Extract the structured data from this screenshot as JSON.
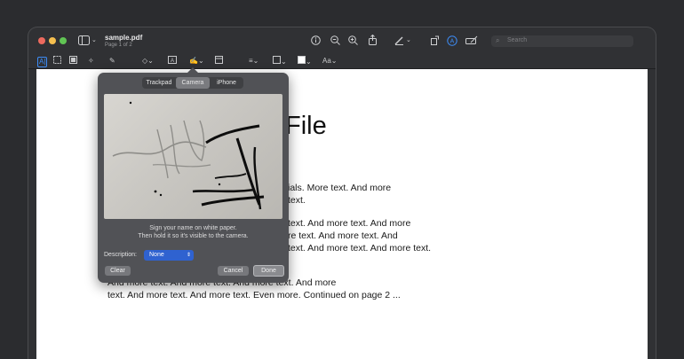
{
  "window": {
    "title": "sample.pdf",
    "subtitle": "Page 1 of 2",
    "search_placeholder": "Search"
  },
  "icons": {
    "sidebar": "sidebar-icon",
    "info": "info-icon",
    "zoom_out": "zoom-out-icon",
    "zoom_in": "zoom-in-icon",
    "share": "share-icon",
    "markup": "pen-icon",
    "rotate": "rotate-icon",
    "highlight": "highlight-icon",
    "edit": "form-edit-icon",
    "search": "search-icon"
  },
  "toolbar": {
    "text_style": "Aa"
  },
  "document": {
    "title_fragment": "File",
    "lines": [
      "ials. More text. And more",
      "text.",
      "text. And more text. And more",
      "re text. And more text. And",
      "text. And more text. And more text.",
      "And more text. And more text. And more text. And more",
      "text. And more text. And more text. Even more. Continued on page 2 ..."
    ]
  },
  "signature_popover": {
    "tabs": [
      "Trackpad",
      "Camera",
      "iPhone"
    ],
    "active_tab": "Camera",
    "hint_line1": "Sign your name on white paper.",
    "hint_line2": "Then hold it so it's visible to the camera.",
    "description_label": "Description:",
    "description_value": "None",
    "clear_label": "Clear",
    "cancel_label": "Cancel",
    "done_label": "Done"
  },
  "colors": {
    "accent": "#3d8df7",
    "select": "#2f62d0"
  }
}
